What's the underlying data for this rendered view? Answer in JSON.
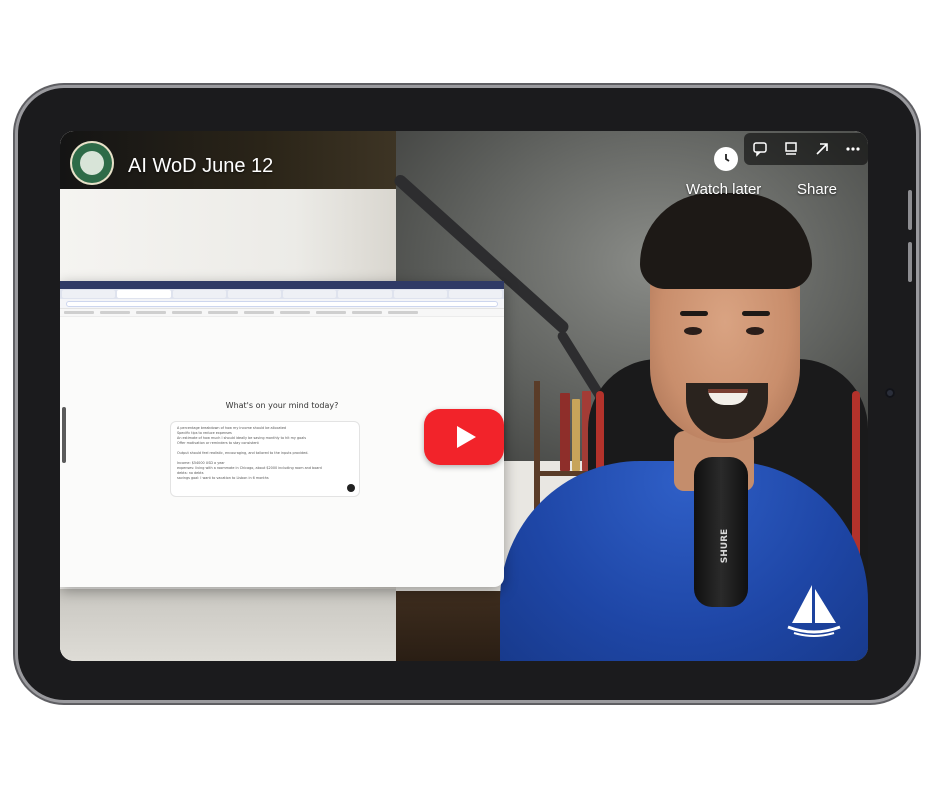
{
  "video": {
    "title": "AI WoD June 12",
    "channel_logo": "channel-logo-icon"
  },
  "overlay": {
    "watch_later_label": "Watch later",
    "share_label": "Share",
    "icons": [
      "comment-icon",
      "playlist-icon",
      "share-arrow-icon",
      "more-icon"
    ]
  },
  "embedded_browser": {
    "heading": "What's on your mind today?",
    "prompt_lines": [
      "A percentage breakdown of how my income should be allocated",
      "Specific tips to reduce expenses",
      "An estimate of how much I should ideally be saving monthly to hit my goals",
      "Offer motivation or reminders to stay consistent",
      "",
      "Output should feel realistic, encouraging, and tailored to the inputs provided.",
      "",
      "Income: $54000 USD a year",
      "expenses: living with a roommate in Chicago, about $2000 including room and board",
      "debts: no debts",
      "savings goal: I want to vacation to Lisbon in 6 months"
    ]
  },
  "colors": {
    "play_red": "#f2232a",
    "shirt_blue": "#1e46a6"
  },
  "mic_brand": "SHURE"
}
